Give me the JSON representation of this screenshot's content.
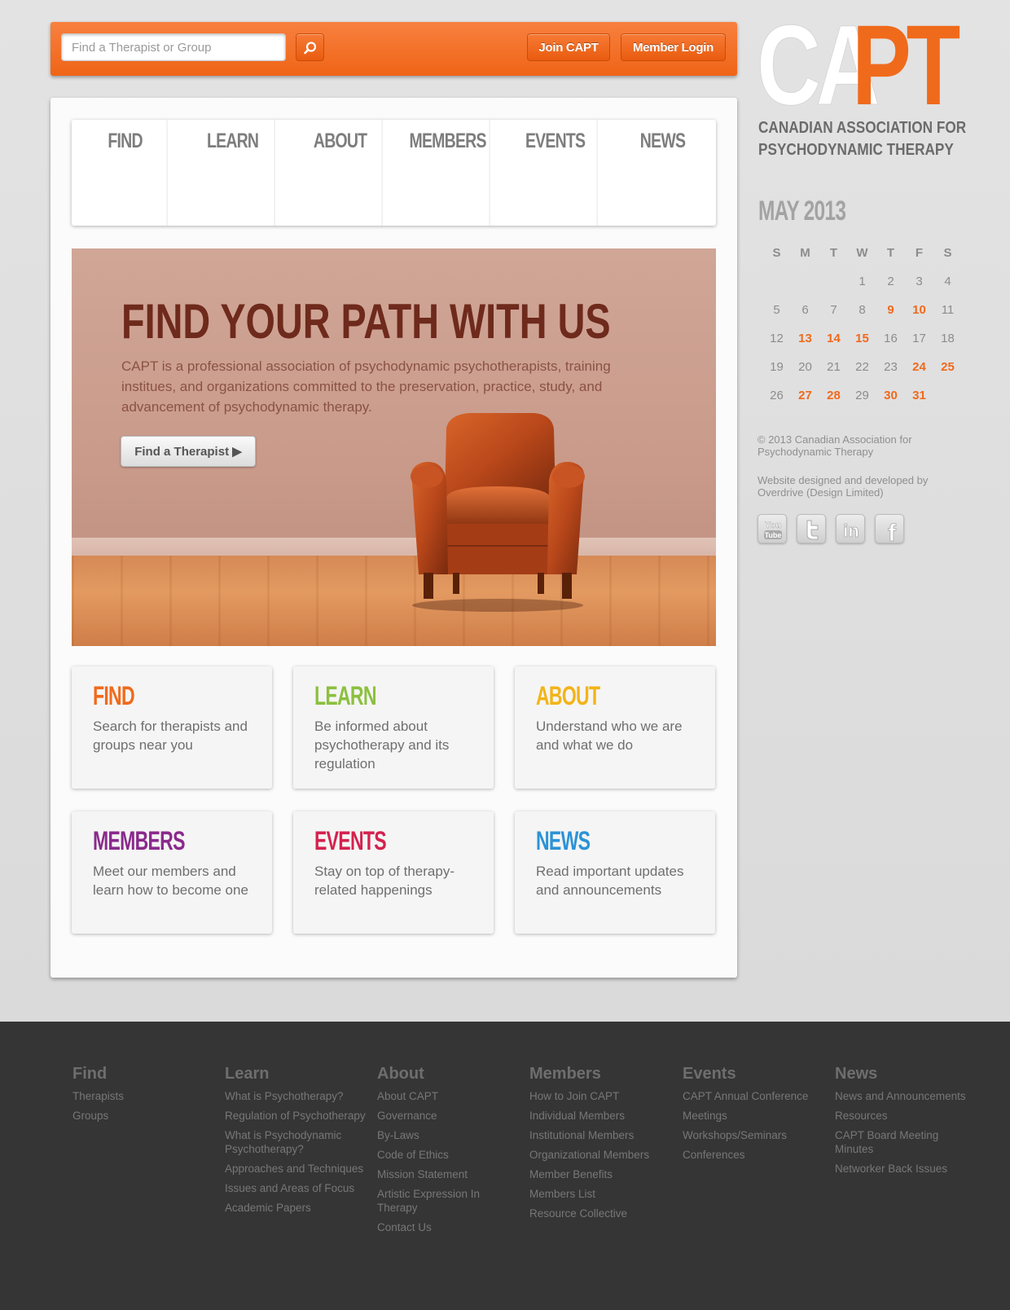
{
  "header": {
    "search_placeholder": "Find a Therapist or Group",
    "join_label": "Join CAPT",
    "login_label": "Member Login"
  },
  "nav": [
    "FIND",
    "LEARN",
    "ABOUT",
    "MEMBERS",
    "EVENTS",
    "NEWS"
  ],
  "hero": {
    "title": "FIND YOUR PATH WITH US",
    "text": "CAPT is a professional association of psychodynamic psychotherapists, training institues, and organizations committed to the preservation, practice, study, and advancement of psychodynamic therapy.",
    "button_label": "Find a Therapist ▶"
  },
  "cards": [
    {
      "title": "FIND",
      "text": "Search for therapists and groups near you",
      "color": "#f06a1c"
    },
    {
      "title": "LEARN",
      "text": "Be informed about psychotherapy and its regulation",
      "color": "#8cc03f"
    },
    {
      "title": "ABOUT",
      "text": "Understand who we are and what we do",
      "color": "#f2b418"
    },
    {
      "title": "MEMBERS",
      "text": "Meet our members and learn how to become one",
      "color": "#8a2a8c"
    },
    {
      "title": "EVENTS",
      "text": "Stay on top of therapy-related happenings",
      "color": "#d4224e"
    },
    {
      "title": "NEWS",
      "text": "Read important updates and announcements",
      "color": "#2b93d6"
    }
  ],
  "sidebar": {
    "logo_text_gray": "CA",
    "logo_text_orange": "PT",
    "org_name_line1": "CANADIAN ASSOCIATION FOR",
    "org_name_line2": "PSYCHODYNAMIC THERAPY",
    "calendar_title": "MAY 2013",
    "weekdays": [
      "S",
      "M",
      "T",
      "W",
      "T",
      "F",
      "S"
    ],
    "weeks": [
      [
        "",
        "",
        "",
        "1",
        "2",
        "3",
        "4"
      ],
      [
        "5",
        "6",
        "7",
        "8",
        "9",
        "10",
        "11"
      ],
      [
        "12",
        "13",
        "14",
        "15",
        "16",
        "17",
        "18"
      ],
      [
        "19",
        "20",
        "21",
        "22",
        "23",
        "24",
        "25"
      ],
      [
        "26",
        "27",
        "28",
        "29",
        "30",
        "31",
        ""
      ]
    ],
    "highlighted_days": [
      "9",
      "10",
      "13",
      "14",
      "15",
      "24",
      "25",
      "27",
      "28",
      "30",
      "31"
    ],
    "copyright": "© 2013 Canadian Association for Psychodynamic Therapy",
    "credit": "Website designed and developed by Overdrive (Design Limited)",
    "social_icons": [
      "youtube-icon",
      "twitter-icon",
      "linkedin-icon",
      "facebook-icon"
    ]
  },
  "footer": [
    {
      "title": "Find",
      "links": [
        "Therapists",
        "Groups"
      ]
    },
    {
      "title": "Learn",
      "links": [
        "What is Psychotherapy?",
        "Regulation of Psychotherapy",
        "What is Psychodynamic Psychotherapy?",
        "Approaches and Techniques",
        "Issues and Areas of Focus",
        "Academic Papers"
      ]
    },
    {
      "title": "About",
      "links": [
        "About CAPT",
        "Governance",
        "By-Laws",
        "Code of Ethics",
        "Mission Statement",
        "Artistic Expression In Therapy",
        "Contact Us"
      ]
    },
    {
      "title": "Members",
      "links": [
        "How to Join CAPT",
        "Individual Members",
        "Institutional Members",
        "Organizational Members",
        "Member Benefits",
        "Members List",
        "Resource Collective"
      ]
    },
    {
      "title": "Events",
      "links": [
        "CAPT Annual Conference",
        "Meetings",
        "Workshops/Seminars",
        "Conferences"
      ]
    },
    {
      "title": "News",
      "links": [
        "News and Announcements",
        "Resources",
        "CAPT Board Meeting Minutes",
        "Networker Back Issues"
      ]
    }
  ],
  "colors": {
    "accent": "#f06a1c",
    "footer_bg": "#353535"
  }
}
